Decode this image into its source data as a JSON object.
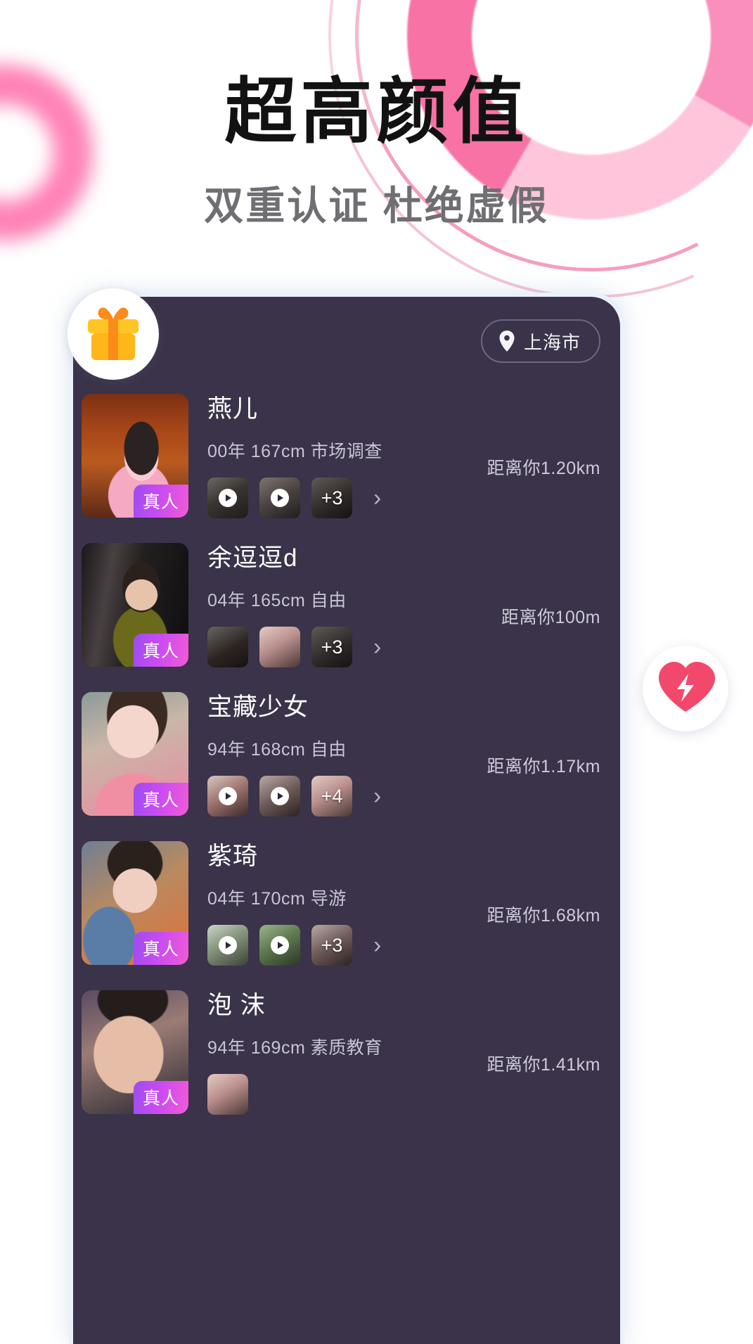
{
  "hero": {
    "title": "超高颜值",
    "subtitle": "双重认证  杜绝虚假",
    "title_color": "#121212",
    "subtitle_color": "#6f6f73",
    "accent_pink": "#f2558f"
  },
  "phone": {
    "background": "#3a3349",
    "location": {
      "icon": "location-pin-icon",
      "label": "上海市"
    },
    "floating": {
      "gift_icon": "gift-icon",
      "match_icon": "heart-bolt-icon"
    },
    "cards": [
      {
        "name": "燕儿",
        "meta": "00年 167cm 市场调查",
        "badge": "真人",
        "distance": "距离你1.20km",
        "more_count": "+3",
        "thumbs": [
          {
            "play": true,
            "overlay": ""
          },
          {
            "play": true,
            "overlay": ""
          },
          {
            "play": false,
            "overlay": "+3"
          }
        ],
        "chevron": "›"
      },
      {
        "name": "余逗逗d",
        "meta": "04年 165cm 自由",
        "badge": "真人",
        "distance": "距离你100m",
        "more_count": "+3",
        "thumbs": [
          {
            "play": false,
            "overlay": ""
          },
          {
            "play": false,
            "overlay": ""
          },
          {
            "play": false,
            "overlay": "+3"
          }
        ],
        "chevron": "›"
      },
      {
        "name": "宝藏少女",
        "meta": "94年 168cm 自由",
        "badge": "真人",
        "distance": "距离你1.17km",
        "more_count": "+4",
        "thumbs": [
          {
            "play": true,
            "overlay": ""
          },
          {
            "play": true,
            "overlay": ""
          },
          {
            "play": false,
            "overlay": "+4"
          }
        ],
        "chevron": "›"
      },
      {
        "name": "紫琦",
        "meta": "04年 170cm 导游",
        "badge": "真人",
        "distance": "距离你1.68km",
        "more_count": "+3",
        "thumbs": [
          {
            "play": true,
            "overlay": ""
          },
          {
            "play": true,
            "overlay": ""
          },
          {
            "play": false,
            "overlay": "+3"
          }
        ],
        "chevron": "›"
      },
      {
        "name": "泡 沫",
        "meta": "94年 169cm 素质教育",
        "badge": "真人",
        "distance": "距离你1.41km",
        "more_count": "",
        "thumbs": [
          {
            "play": false,
            "overlay": ""
          }
        ],
        "chevron": ""
      }
    ]
  }
}
